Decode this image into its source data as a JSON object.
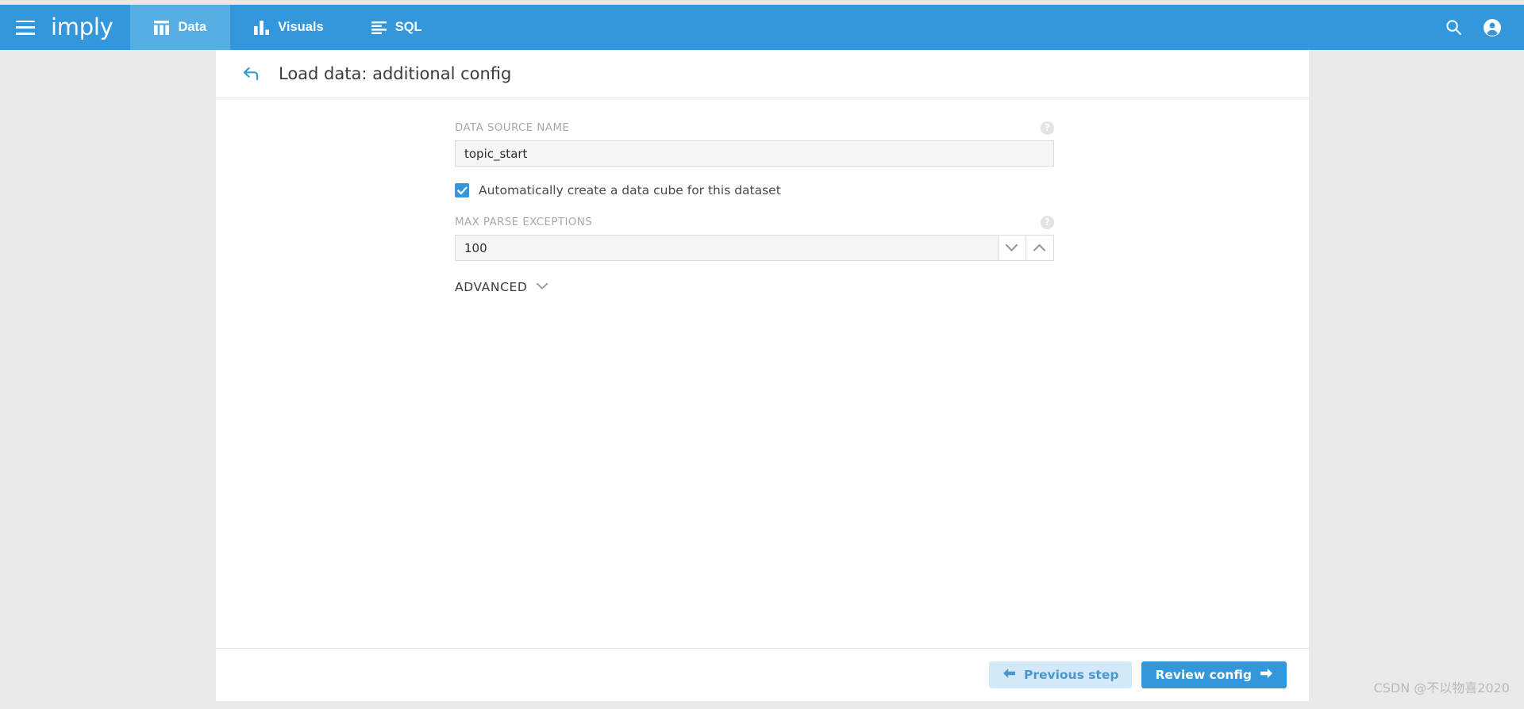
{
  "navbar": {
    "menu_icon": "hamburger-icon",
    "logo": "imply",
    "tabs": [
      {
        "label": "Data",
        "icon": "table-icon",
        "active": true
      },
      {
        "label": "Visuals",
        "icon": "bar-chart-icon",
        "active": false
      },
      {
        "label": "SQL",
        "icon": "sql-lines-icon",
        "active": false
      }
    ],
    "actions": [
      {
        "name": "search-icon",
        "label": "Search"
      },
      {
        "name": "account-icon",
        "label": "Account"
      }
    ],
    "background_color": "#3398db",
    "active_tab_color": "#56aee4"
  },
  "page": {
    "back_icon": "back-arrow-icon",
    "title": "Load data: additional config"
  },
  "form": {
    "datasource": {
      "label": "DATA SOURCE NAME",
      "value": "topic_start",
      "placeholder": "",
      "help_icon": "help-circle-icon"
    },
    "auto_cube": {
      "label": "Automatically create a data cube for this dataset",
      "checked": true,
      "check_icon": "checkmark-icon"
    },
    "max_parse_exceptions": {
      "label": "MAX PARSE EXCEPTIONS",
      "value": "100",
      "placeholder": "",
      "help_icon": "help-circle-icon",
      "decrement_icon": "chevron-down-icon",
      "increment_icon": "chevron-up-icon"
    },
    "advanced": {
      "label": "ADVANCED",
      "toggle_icon": "chevron-down-icon",
      "expanded": false
    }
  },
  "footer": {
    "previous_label": "Previous step",
    "previous_icon": "arrow-left-icon",
    "review_label": "Review config",
    "review_icon": "arrow-right-icon"
  },
  "watermark": {
    "text": "CSDN @不以物喜2020"
  }
}
